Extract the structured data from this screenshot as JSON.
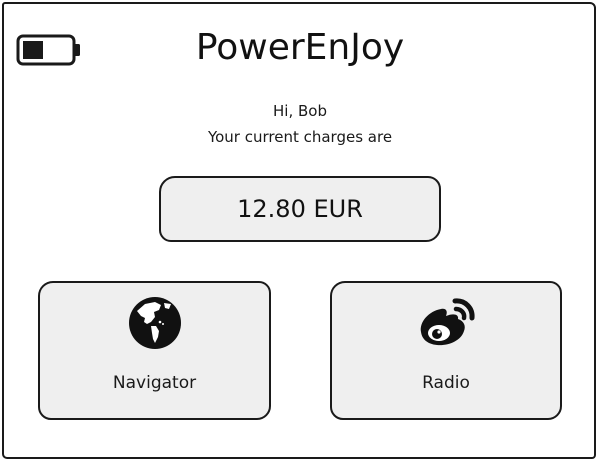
{
  "header": {
    "title": "PowerEnJoy",
    "battery_icon": "battery-low-icon"
  },
  "greeting": {
    "hello": "Hi, Bob",
    "subtitle": "Your current charges are"
  },
  "charges": {
    "value": "12.80 EUR"
  },
  "tiles": [
    {
      "label": "Navigator",
      "icon": "globe-icon"
    },
    {
      "label": "Radio",
      "icon": "weibo-radio-icon"
    }
  ],
  "colors": {
    "stroke": "#1a1a1a",
    "panel_fill": "#efefef",
    "background": "#ffffff"
  }
}
